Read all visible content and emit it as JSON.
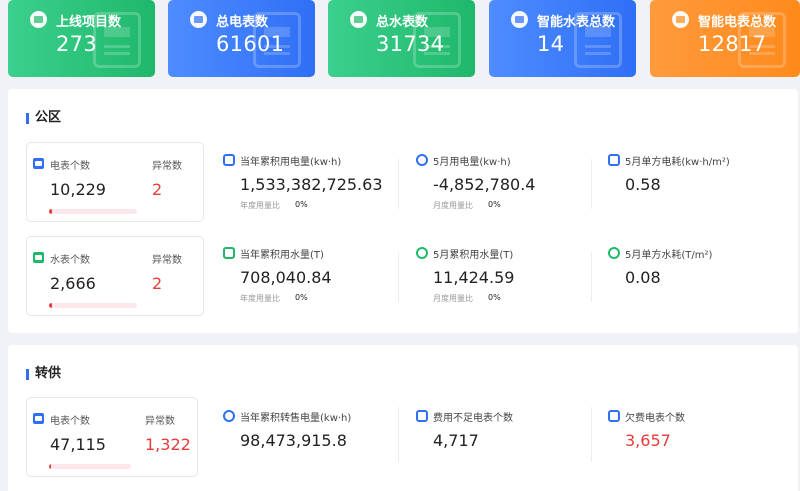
{
  "colors": {
    "primary": "#2f6ff5",
    "danger": "#e83a3a",
    "green": "#1fb86a",
    "orange": "#ff8a1c"
  },
  "stats": [
    {
      "label": "上线项目数",
      "value": "273",
      "icon": "project-icon",
      "color": "#2ec27e"
    },
    {
      "label": "总电表数",
      "value": "61601",
      "icon": "electric-meter-icon",
      "color": "#2f6ff5"
    },
    {
      "label": "总水表数",
      "value": "31734",
      "icon": "water-meter-icon",
      "color": "#2ec27e"
    },
    {
      "label": "智能水表总数",
      "value": "14",
      "icon": "smart-water-meter-icon",
      "color": "#2f6ff5"
    },
    {
      "label": "智能电表总数",
      "value": "12817",
      "icon": "smart-electric-meter-icon",
      "color": "#ff8a1c"
    }
  ],
  "public": {
    "title": "公区",
    "electric_box": {
      "label": "电表个数",
      "value": "10,229",
      "abnormal_label": "异常数",
      "abnormal_value": "2",
      "abnormal_ratio": 0.0002
    },
    "water_box": {
      "label": "水表个数",
      "value": "2,666",
      "abnormal_label": "异常数",
      "abnormal_value": "2",
      "abnormal_ratio": 0.0008
    },
    "metrics": [
      {
        "label": "当年累积用电量(kw·h)",
        "value": "1,533,382,725.63",
        "sub_label": "年度用量比",
        "sub_value": "0%",
        "icon": "chart-up-icon"
      },
      {
        "label": "5月用电量(kw·h)",
        "value": "-4,852,780.4",
        "sub_label": "月度用量比",
        "sub_value": "0%",
        "icon": "lightning-icon"
      },
      {
        "label": "5月单方电耗(kw·h/m²)",
        "value": "0.58",
        "icon": "ruler-icon"
      },
      {
        "label": "当年累积用水量(T)",
        "value": "708,040.84",
        "sub_label": "年度用量比",
        "sub_value": "0%",
        "icon": "chart-up-icon"
      },
      {
        "label": "5月累积用水量(T)",
        "value": "11,424.59",
        "sub_label": "月度用量比",
        "sub_value": "0%",
        "icon": "water-drop-icon"
      },
      {
        "label": "5月单方水耗(T/m²)",
        "value": "0.08",
        "icon": "gauge-icon"
      }
    ]
  },
  "transfer": {
    "title": "转供",
    "electric_box": {
      "label": "电表个数",
      "value": "47,115",
      "abnormal_label": "异常数",
      "abnormal_value": "1,322",
      "abnormal_ratio": 0.028
    },
    "metrics": [
      {
        "label": "当年累积转售电量(kw·h)",
        "value": "98,473,915.8",
        "icon": "lightning-icon"
      },
      {
        "label": "费用不足电表个数",
        "value": "4,717",
        "icon": "meter-warning-icon"
      },
      {
        "label": "欠费电表个数",
        "value": "3,657",
        "icon": "meter-debt-icon"
      }
    ]
  }
}
